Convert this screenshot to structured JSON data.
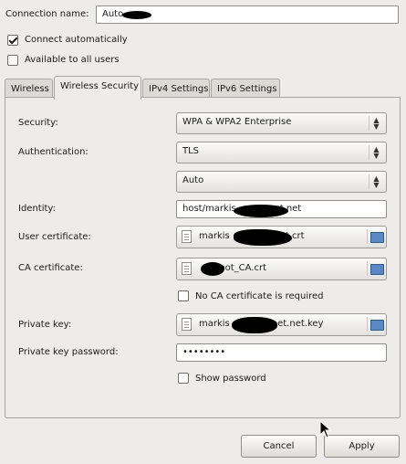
{
  "connection": {
    "name_label": "Connection name:",
    "name_value": "Auto "
  },
  "options": {
    "connect_auto_label": "Connect automatically",
    "connect_auto_checked": true,
    "all_users_label": "Available to all users",
    "all_users_checked": false
  },
  "tabs": [
    {
      "label": "Wireless",
      "active": false
    },
    {
      "label": "Wireless Security",
      "active": true
    },
    {
      "label": "IPv4 Settings",
      "active": false
    },
    {
      "label": "IPv6 Settings",
      "active": false
    }
  ],
  "security": {
    "security_label": "Security:",
    "security_value": "WPA & WPA2 Enterprise",
    "auth_label": "Authentication:",
    "auth_value": "TLS",
    "auth_sub_value": "Auto",
    "identity_label": "Identity:",
    "identity_value": "host/markis",
    "identity_tail": "t.net",
    "user_cert_label": "User certificate:",
    "user_cert_value": "markis",
    "user_cert_tail": "et.crt",
    "ca_cert_label": "CA certificate:",
    "ca_cert_value": "Root_CA.crt",
    "no_ca_label": "No CA certificate is required",
    "no_ca_checked": false,
    "private_key_label": "Private key:",
    "private_key_value": "markis",
    "private_key_tail": "net.net.key",
    "private_key_password_label": "Private key password:",
    "private_key_password_value": "••••••••",
    "show_password_label": "Show password",
    "show_password_checked": false
  },
  "buttons": {
    "cancel": "Cancel",
    "apply": "Apply"
  }
}
